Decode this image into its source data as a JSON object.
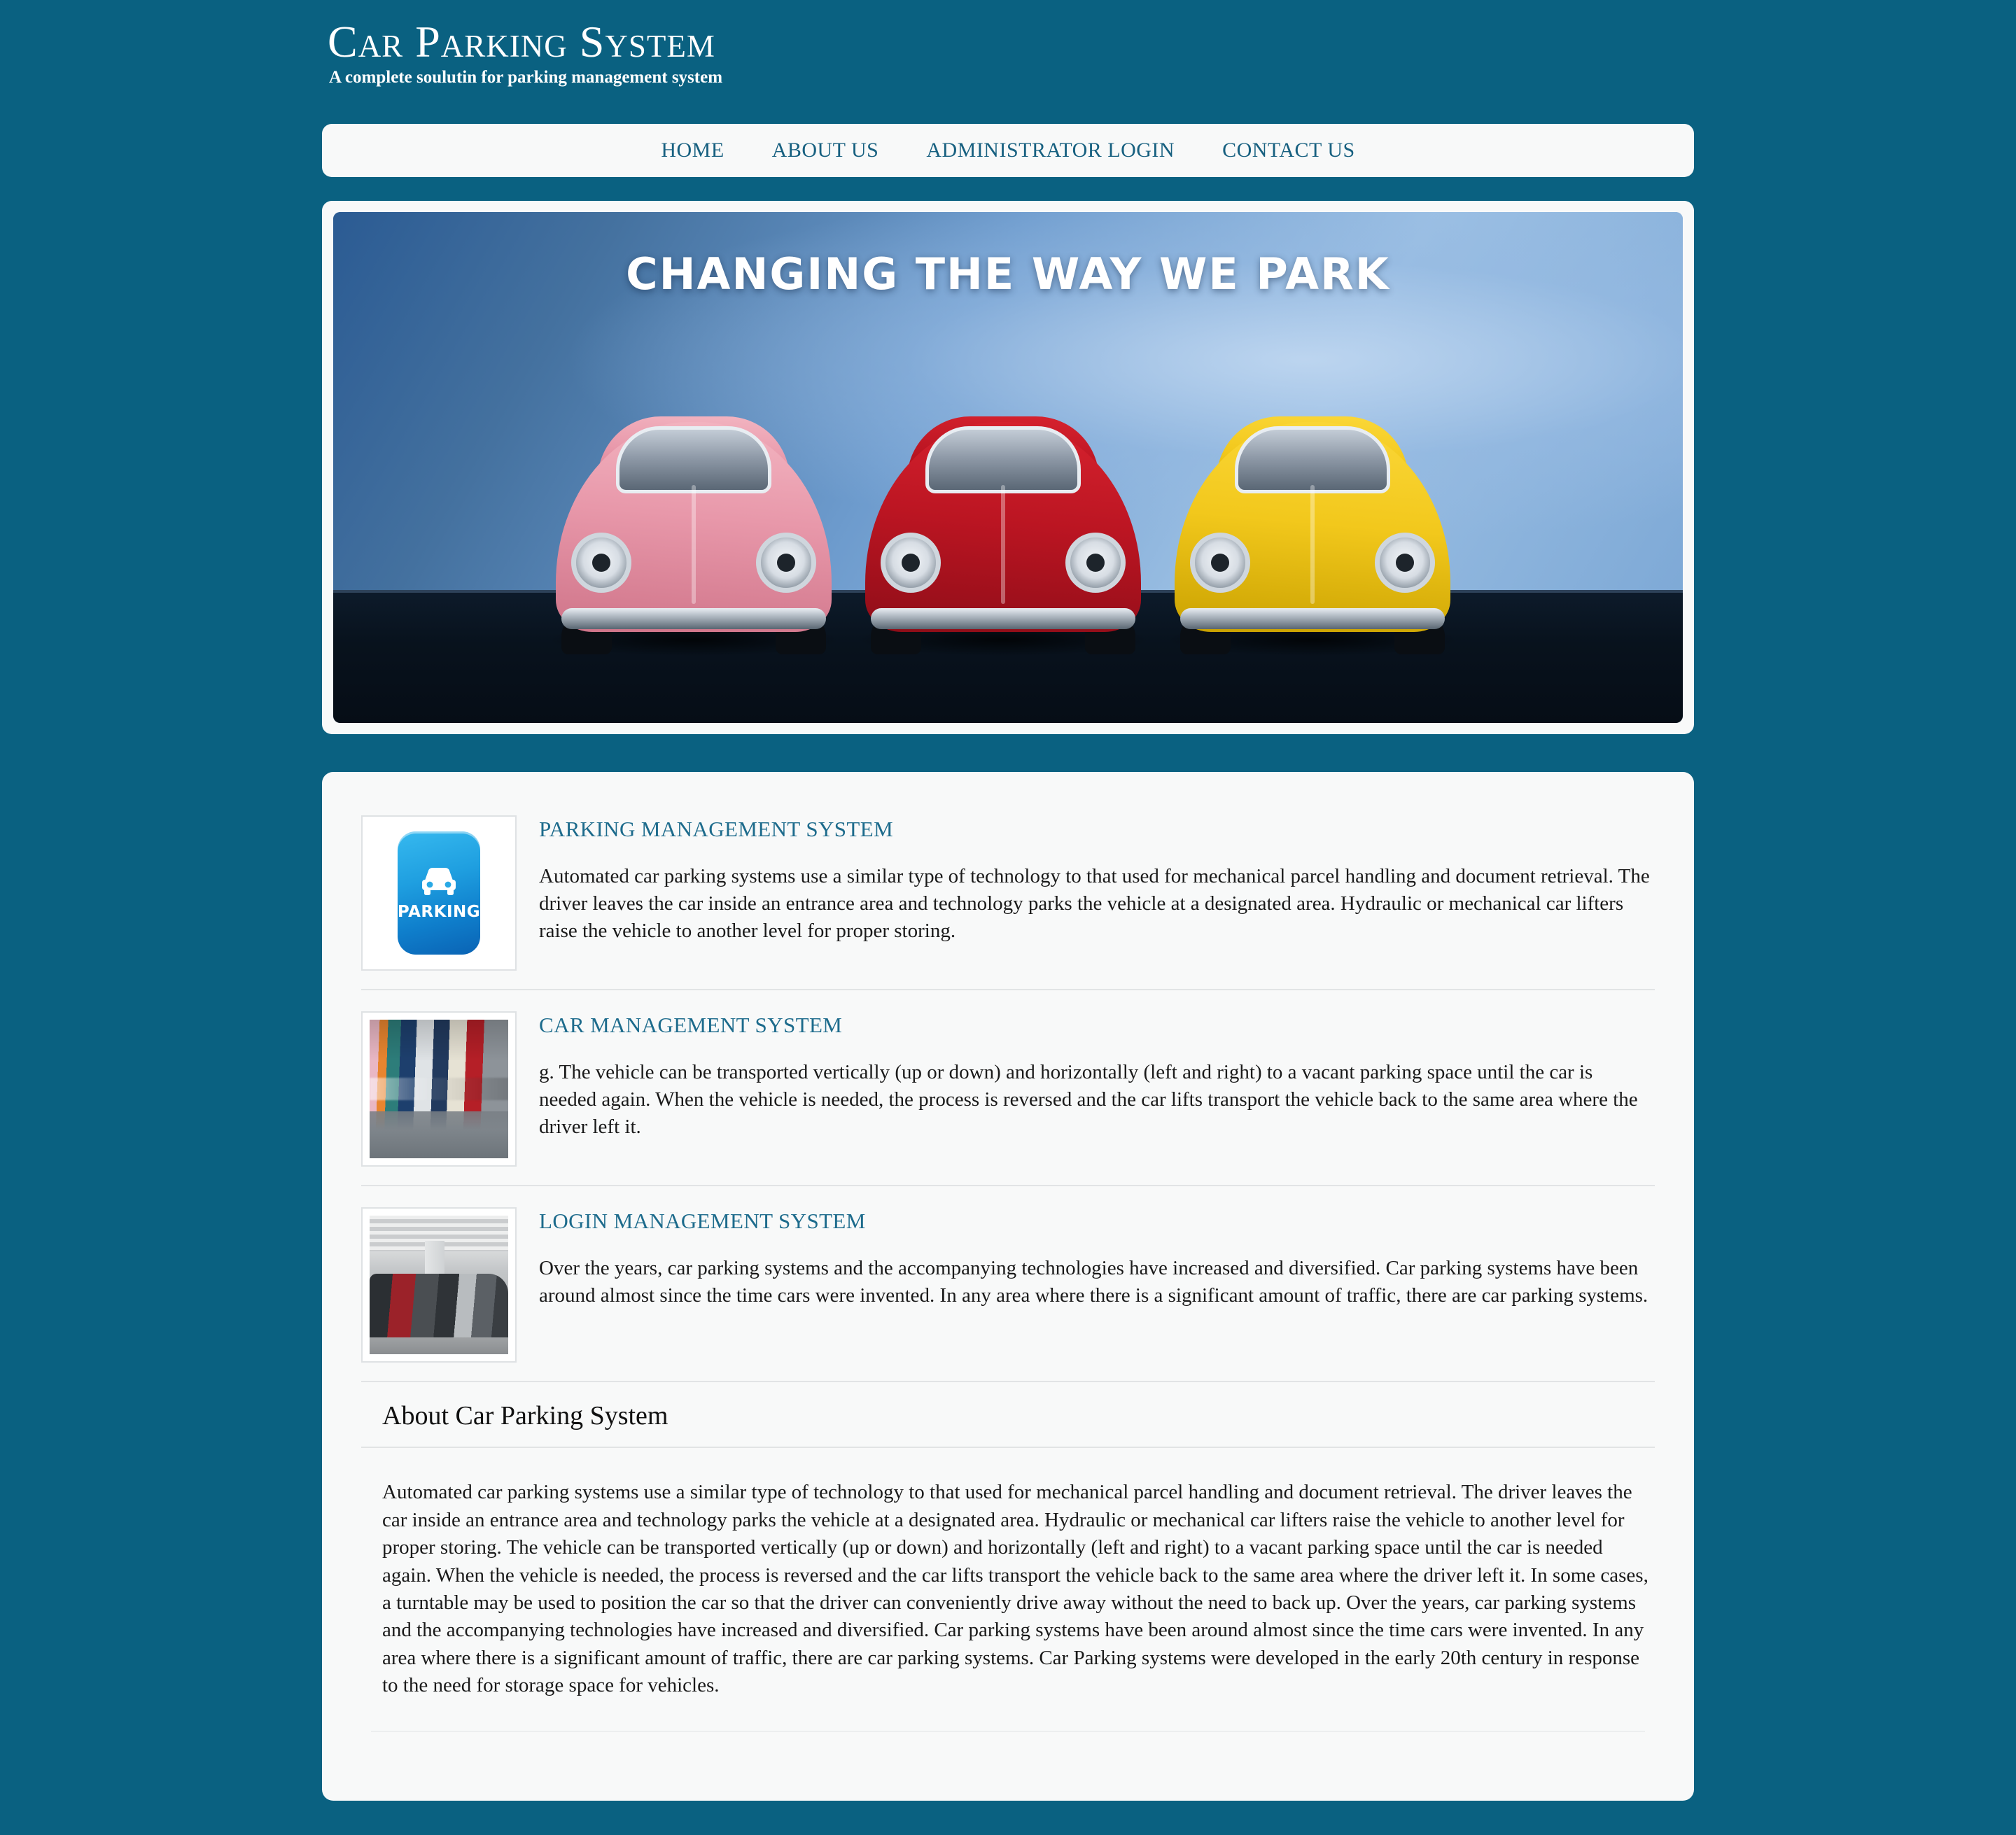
{
  "theme": {
    "page_background": "#0a6181",
    "panel_background": "#f8f9f9",
    "accent_link": "#176080",
    "heading_accent": "#1d6b8c"
  },
  "header": {
    "title": "Car Parking System",
    "tagline": "A complete soulutin for parking management system"
  },
  "nav": {
    "items": [
      {
        "label": "Home"
      },
      {
        "label": "About Us"
      },
      {
        "label": "Administrator Login"
      },
      {
        "label": "Contact Us"
      }
    ]
  },
  "hero": {
    "headline": "CHANGING THE WAY WE PARK",
    "cars": [
      {
        "color_name": "pink",
        "color": "#e898aa"
      },
      {
        "color_name": "red",
        "color": "#bb1522"
      },
      {
        "color_name": "yellow",
        "color": "#f2c81c"
      }
    ]
  },
  "features": [
    {
      "title": "Parking Management System",
      "thumb": "parking-badge-icon",
      "thumb_label": "PARKING",
      "body": "Automated car parking systems use a similar type of technology to that used for mechanical parcel handling and document retrieval. The driver leaves the car inside an entrance area and technology parks the vehicle at a designated area. Hydraulic or mechanical car lifters raise the vehicle to another level for proper storing."
    },
    {
      "title": "Car Management System",
      "thumb": "parked-cars-photo",
      "body": "g. The vehicle can be transported vertically (up or down) and horizontally (left and right) to a vacant parking space until the car is needed again. When the vehicle is needed, the process is reversed and the car lifts transport the vehicle back to the same area where the driver left it."
    },
    {
      "title": "Login Management System",
      "thumb": "parking-garage-photo",
      "body": "Over the years, car parking systems and the accompanying technologies have increased and diversified. Car parking systems have been around almost since the time cars were invented. In any area where there is a significant amount of traffic, there are car parking systems."
    }
  ],
  "about": {
    "title": "About Car Parking System",
    "body": "Automated car parking systems use a similar type of technology to that used for mechanical parcel handling and document retrieval. The driver leaves the car inside an entrance area and technology parks the vehicle at a designated area. Hydraulic or mechanical car lifters raise the vehicle to another level for proper storing. The vehicle can be transported vertically (up or down) and horizontally (left and right) to a vacant parking space until the car is needed again. When the vehicle is needed, the process is reversed and the car lifts transport the vehicle back to the same area where the driver left it. In some cases, a turntable may be used to position the car so that the driver can conveniently drive away without the need to back up. Over the years, car parking systems and the accompanying technologies have increased and diversified. Car parking systems have been around almost since the time cars were invented. In any area where there is a significant amount of traffic, there are car parking systems. Car Parking systems were developed in the early 20th century in response to the need for storage space for vehicles."
  }
}
